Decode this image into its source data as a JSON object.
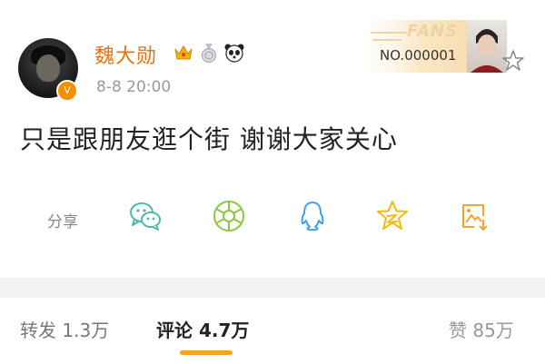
{
  "post": {
    "username": "魏大勋",
    "timestamp": "8-8 20:00",
    "text": "只是跟朋友逛个街 谢谢大家关心",
    "verified_icon": "v-icon"
  },
  "fans_card": {
    "label": "FANS",
    "number": "NO.000001"
  },
  "share": {
    "label": "分享",
    "icons": [
      "wechat-icon",
      "moments-icon",
      "qq-icon",
      "qzone-icon",
      "save-image-icon"
    ]
  },
  "tabs": {
    "repost": "转发 1.3万",
    "comment": "评论 4.7万",
    "likes": "赞 85万"
  },
  "colors": {
    "username": "#e8700e",
    "accent": "#f7a21a",
    "share_icons": "#53b6a6"
  }
}
